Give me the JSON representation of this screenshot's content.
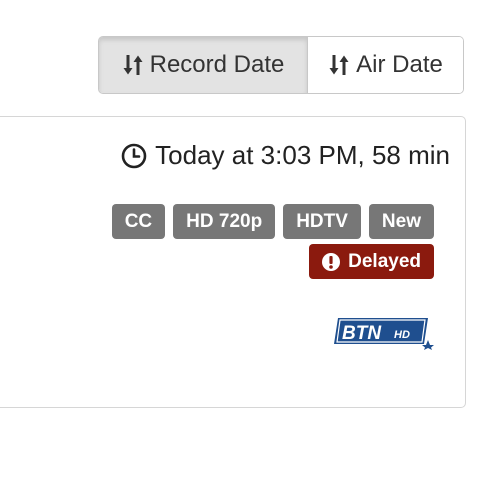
{
  "sort": {
    "record_label": "Record Date",
    "air_label": "Air Date",
    "active": "record"
  },
  "recording": {
    "time_text": "Today at 3:03 PM, 58 min",
    "tags": [
      "CC",
      "HD 720p",
      "HDTV",
      "New"
    ],
    "status_label": "Delayed",
    "channel_logo": "BTNHD",
    "colors": {
      "tag_bg": "#777777",
      "delayed_bg": "#8b1a0e",
      "logo_blue": "#1f4f8f"
    }
  },
  "icons": {
    "sort": "sort-arrows-icon",
    "time": "clock-icon",
    "status": "exclamation-circle-icon"
  }
}
